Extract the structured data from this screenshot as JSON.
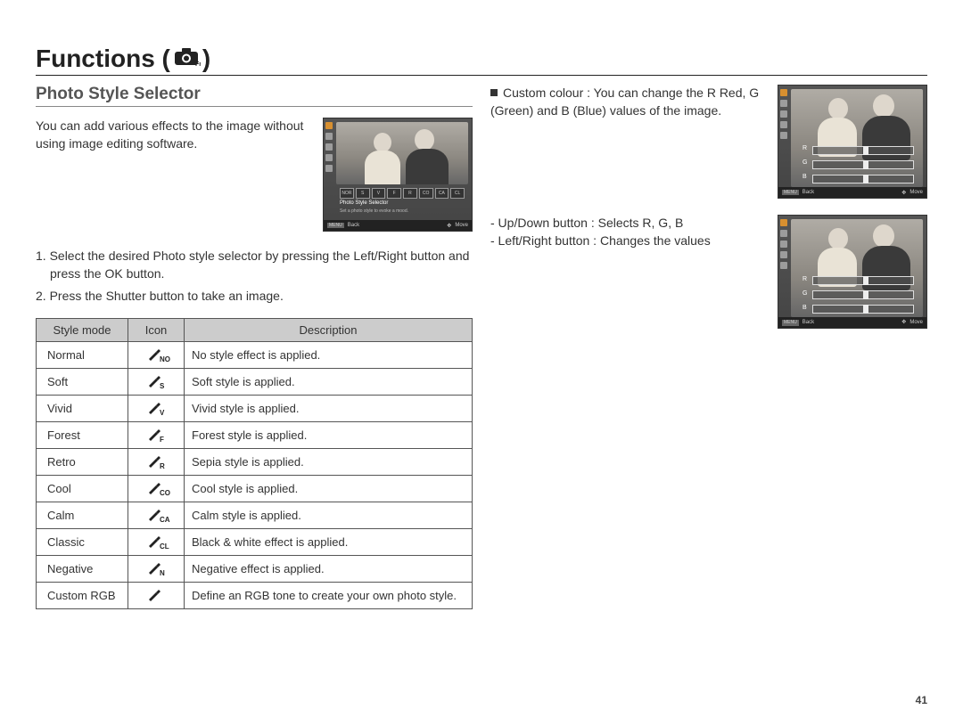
{
  "heading": "Functions (",
  "heading_close": ")",
  "camera_icon_label": "Fn",
  "section_title": "Photo Style Selector",
  "intro_text": "You can add various effects to the image without using image editing software.",
  "steps": [
    "1. Select the desired Photo style selector by pressing the Left/Right button and press the OK button.",
    "2. Press the Shutter button to take an image."
  ],
  "table": {
    "headers": {
      "mode": "Style mode",
      "icon": "Icon",
      "description": "Description"
    },
    "rows": [
      {
        "mode": "Normal",
        "icon_sub": "NOR",
        "description": "No style effect is applied."
      },
      {
        "mode": "Soft",
        "icon_sub": "S",
        "description": "Soft style is applied."
      },
      {
        "mode": "Vivid",
        "icon_sub": "V",
        "description": "Vivid style is applied."
      },
      {
        "mode": "Forest",
        "icon_sub": "F",
        "description": "Forest style is applied."
      },
      {
        "mode": "Retro",
        "icon_sub": "R",
        "description": "Sepia style is applied."
      },
      {
        "mode": "Cool",
        "icon_sub": "CO",
        "description": "Cool style is applied."
      },
      {
        "mode": "Calm",
        "icon_sub": "CA",
        "description": "Calm style is applied."
      },
      {
        "mode": "Classic",
        "icon_sub": "CL",
        "description": "Black & white effect is applied."
      },
      {
        "mode": "Negative",
        "icon_sub": "N",
        "description": "Negative effect is applied."
      },
      {
        "mode": "Custom RGB",
        "icon_sub": "",
        "description": "Define an RGB tone to create your own photo style."
      }
    ]
  },
  "custom_colour": {
    "bullet_head": "Custom colour : ",
    "bullet_body": "You can change the R Red, G (Green) and B (Blue) values of the image.",
    "line1": "- Up/Down button : Selects R, G, B",
    "line2": "- Left/Right button : Changes the values"
  },
  "screen1": {
    "strip": [
      "NOR",
      "S",
      "V",
      "F",
      "R",
      "CO",
      "CA",
      "CL"
    ],
    "caption1": "Photo Style Selector",
    "caption2": "Set a photo style to evoke a mood.",
    "footer_back": "Back",
    "footer_back_tag": "MENU",
    "footer_move": "Move"
  },
  "screen_rgb": {
    "channels": [
      "R",
      "G",
      "B"
    ],
    "footer_back": "Back",
    "footer_back_tag": "MENU",
    "footer_move": "Move"
  },
  "page_number": "41"
}
